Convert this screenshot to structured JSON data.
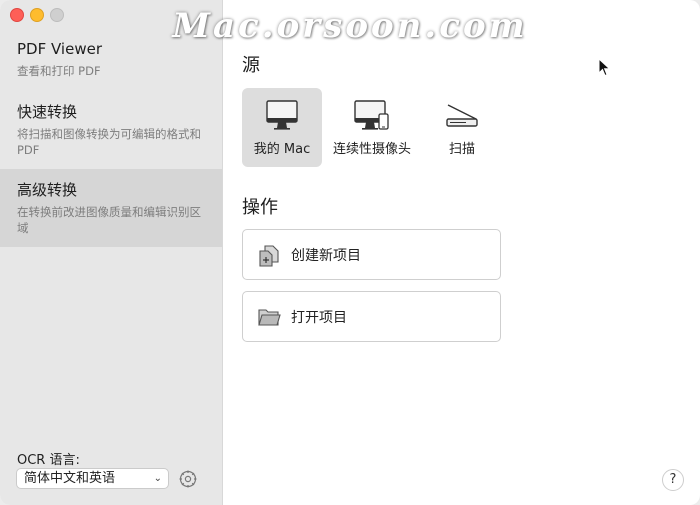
{
  "watermark": "Mac.orsoon.com",
  "sidebar": {
    "items": [
      {
        "title": "PDF Viewer",
        "desc": "查看和打印 PDF",
        "selected": false
      },
      {
        "title": "快速转换",
        "desc": "将扫描和图像转换为可编辑的格式和 PDF",
        "selected": false
      },
      {
        "title": "高级转换",
        "desc": "在转换前改进图像质量和编辑识别区域",
        "selected": true
      }
    ],
    "ocr_label": "OCR 语言:",
    "ocr_value": "简体中文和英语",
    "ocr_icon": "chevron-down-icon",
    "settings_icon": "gear-icon"
  },
  "main": {
    "source_heading": "源",
    "sources": [
      {
        "label": "我的 Mac",
        "icon": "imac-icon",
        "selected": true
      },
      {
        "label": "连续性摄像头",
        "icon": "continuity-camera-icon",
        "selected": false
      },
      {
        "label": "扫描",
        "icon": "scanner-icon",
        "selected": false
      }
    ],
    "actions_heading": "操作",
    "actions": [
      {
        "label": "创建新项目",
        "icon": "new-project-icon"
      },
      {
        "label": "打开项目",
        "icon": "folder-icon"
      }
    ],
    "help_label": "?"
  },
  "colors": {
    "sidebar_bg": "#e7e7e7",
    "sidebar_selected": "#d6d6d6",
    "source_selected": "#dddddd",
    "close": "#fe5f57",
    "minimize": "#febc2e",
    "maximize_inactive": "#cfcfcf"
  }
}
